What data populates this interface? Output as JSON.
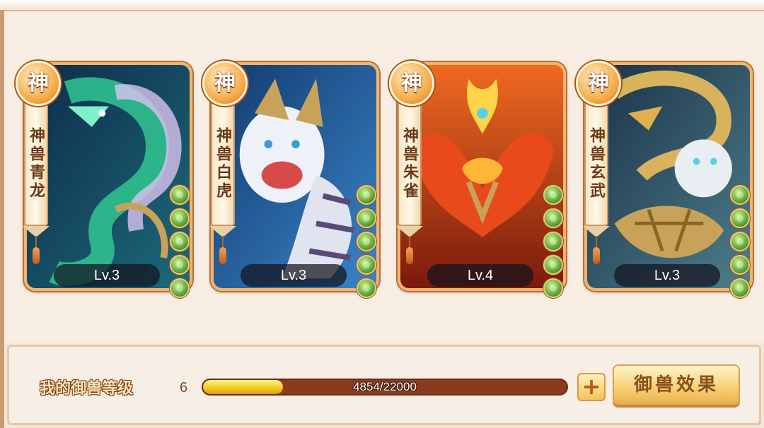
{
  "cards": [
    {
      "badge": "神",
      "name": "神兽青龙",
      "level": "Lv.3",
      "gems": 5,
      "colors": {
        "bg1": "#0e2b4a",
        "bg2": "#1c6a7a",
        "main": "#2fbf8f",
        "accent": "#d9c3ef"
      }
    },
    {
      "badge": "神",
      "name": "神兽白虎",
      "level": "Lv.3",
      "gems": 5,
      "colors": {
        "bg1": "#123a6e",
        "bg2": "#3a84c8",
        "main": "#eef2f8",
        "accent": "#c9a25a"
      }
    },
    {
      "badge": "神",
      "name": "神兽朱雀",
      "level": "Lv.4",
      "gems": 5,
      "colors": {
        "bg1": "#7a1a0c",
        "bg2": "#ef6a21",
        "main": "#e84a1c",
        "accent": "#ffd34a"
      }
    },
    {
      "badge": "神",
      "name": "神兽玄武",
      "level": "Lv.3",
      "gems": 5,
      "colors": {
        "bg1": "#1a3148",
        "bg2": "#4d7e8a",
        "main": "#d9b35c",
        "accent": "#e8eef2"
      }
    }
  ],
  "bottom": {
    "level_label": "我的御兽等级",
    "level_value": "6",
    "progress_text": "4854/22000",
    "progress_fraction": 0.22,
    "plus_label": "+",
    "effect_button_label": "御兽效果"
  }
}
